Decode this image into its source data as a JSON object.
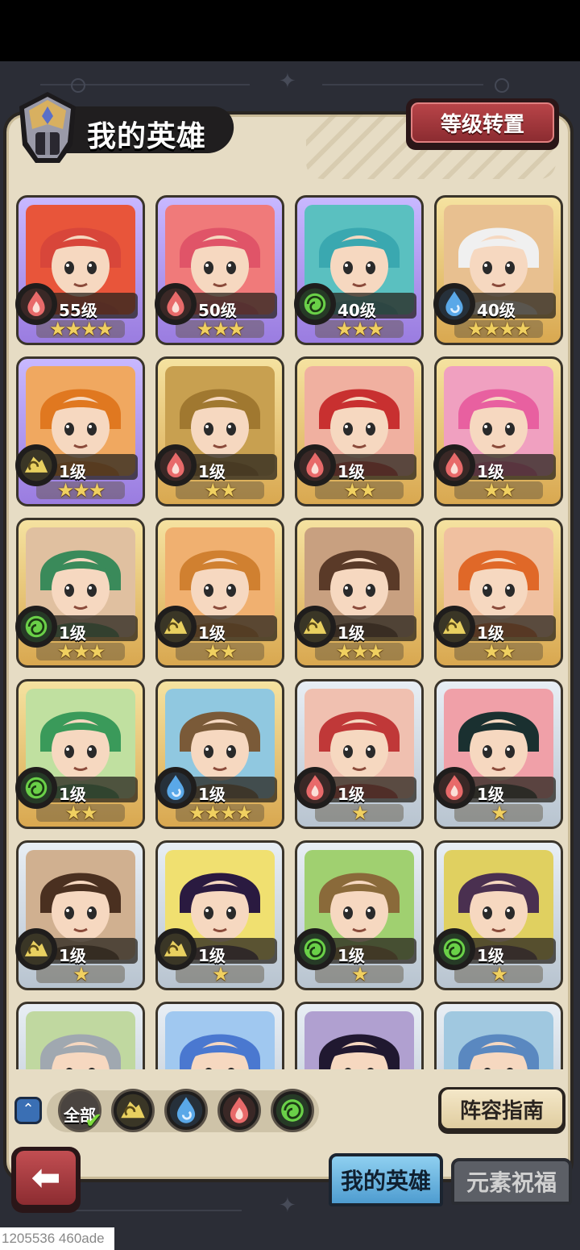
{
  "header": {
    "title": "我的英雄",
    "level_transfer_label": "等级转置"
  },
  "heroes": [
    {
      "level": "55级",
      "stars": "★★★★",
      "star_count": 4,
      "element": "fire",
      "frame": "purple",
      "portrait_color": "#e8553a",
      "hair_color": "#d8463a"
    },
    {
      "level": "50级",
      "stars": "★★★",
      "star_count": 3,
      "element": "fire",
      "frame": "purple",
      "portrait_color": "#f07a7a",
      "hair_color": "#e05468"
    },
    {
      "level": "40级",
      "stars": "★★★",
      "star_count": 3,
      "element": "wind",
      "frame": "purple",
      "portrait_color": "#5ac0c0",
      "hair_color": "#3aa8b0"
    },
    {
      "level": "40级",
      "stars": "★★★★",
      "star_count": 4,
      "element": "water",
      "frame": "gold",
      "portrait_color": "#e8c090",
      "hair_color": "#f0f0f0"
    },
    {
      "level": "1级",
      "stars": "★★★",
      "star_count": 3,
      "element": "earth",
      "frame": "purple",
      "portrait_color": "#f0a860",
      "hair_color": "#e07820"
    },
    {
      "level": "1级",
      "stars": "★★",
      "star_count": 2,
      "element": "fire",
      "frame": "gold",
      "portrait_color": "#c8a050",
      "hair_color": "#a07830"
    },
    {
      "level": "1级",
      "stars": "★★",
      "star_count": 2,
      "element": "fire",
      "frame": "gold",
      "portrait_color": "#f0b0a0",
      "hair_color": "#c83030"
    },
    {
      "level": "1级",
      "stars": "★★",
      "star_count": 2,
      "element": "fire",
      "frame": "gold",
      "portrait_color": "#f0a0c0",
      "hair_color": "#e860a0"
    },
    {
      "level": "1级",
      "stars": "★★★",
      "star_count": 3,
      "element": "wind",
      "frame": "gold",
      "portrait_color": "#e0c0a0",
      "hair_color": "#3a8a5a"
    },
    {
      "level": "1级",
      "stars": "★★",
      "star_count": 2,
      "element": "earth",
      "frame": "gold",
      "portrait_color": "#f0b070",
      "hair_color": "#d08030"
    },
    {
      "level": "1级",
      "stars": "★★★",
      "star_count": 3,
      "element": "earth",
      "frame": "gold",
      "portrait_color": "#c8a080",
      "hair_color": "#5a3a28"
    },
    {
      "level": "1级",
      "stars": "★★",
      "star_count": 2,
      "element": "earth",
      "frame": "gold",
      "portrait_color": "#f0c0a0",
      "hair_color": "#e06828"
    },
    {
      "level": "1级",
      "stars": "★★",
      "star_count": 2,
      "element": "wind",
      "frame": "gold",
      "portrait_color": "#c0e0a0",
      "hair_color": "#3a9a5a"
    },
    {
      "level": "1级",
      "stars": "★★★★",
      "star_count": 4,
      "element": "water",
      "frame": "gold",
      "portrait_color": "#90c8e0",
      "hair_color": "#7a5a38"
    },
    {
      "level": "1级",
      "stars": "★",
      "star_count": 1,
      "element": "fire",
      "frame": "silver",
      "portrait_color": "#f0c0b0",
      "hair_color": "#c03838"
    },
    {
      "level": "1级",
      "stars": "★",
      "star_count": 1,
      "element": "fire",
      "frame": "silver",
      "portrait_color": "#f0a0a8",
      "hair_color": "#1a3030"
    },
    {
      "level": "1级",
      "stars": "★",
      "star_count": 1,
      "element": "earth",
      "frame": "silver",
      "portrait_color": "#d0b090",
      "hair_color": "#4a3020"
    },
    {
      "level": "1级",
      "stars": "★",
      "star_count": 1,
      "element": "earth",
      "frame": "silver",
      "portrait_color": "#f0e070",
      "hair_color": "#2a1a40"
    },
    {
      "level": "1级",
      "stars": "★",
      "star_count": 1,
      "element": "wind",
      "frame": "silver",
      "portrait_color": "#a0d070",
      "hair_color": "#8a6a3a"
    },
    {
      "level": "1级",
      "stars": "★",
      "star_count": 1,
      "element": "wind",
      "frame": "silver",
      "portrait_color": "#e0d060",
      "hair_color": "#4a3050"
    },
    {
      "level": "",
      "stars": "",
      "star_count": 0,
      "element": "none",
      "frame": "silver",
      "portrait_color": "#c0d8a0",
      "hair_color": "#a0a8b0"
    },
    {
      "level": "",
      "stars": "",
      "star_count": 0,
      "element": "none",
      "frame": "silver",
      "portrait_color": "#a0c8f0",
      "hair_color": "#4a78d0"
    },
    {
      "level": "",
      "stars": "",
      "star_count": 0,
      "element": "none",
      "frame": "silver",
      "portrait_color": "#b0a0d0",
      "hair_color": "#201830"
    },
    {
      "level": "",
      "stars": "",
      "star_count": 0,
      "element": "none",
      "frame": "silver",
      "portrait_color": "#a0c8e0",
      "hair_color": "#5a88c0"
    }
  ],
  "filters": {
    "all_label": "全部",
    "items": [
      {
        "name": "all",
        "selected": true
      },
      {
        "name": "earth",
        "selected": false
      },
      {
        "name": "water",
        "selected": false
      },
      {
        "name": "fire",
        "selected": false
      },
      {
        "name": "wind",
        "selected": false
      }
    ]
  },
  "lineup_guide_label": "阵容指南",
  "tabs": [
    {
      "label": "我的英雄",
      "active": true
    },
    {
      "label": "元素祝福",
      "active": false
    }
  ],
  "colors": {
    "fire": "#e86a6a",
    "water": "#5aa8e8",
    "wind": "#6ad048",
    "earth": "#e8d060"
  },
  "footer_id": "1205536 460ade"
}
